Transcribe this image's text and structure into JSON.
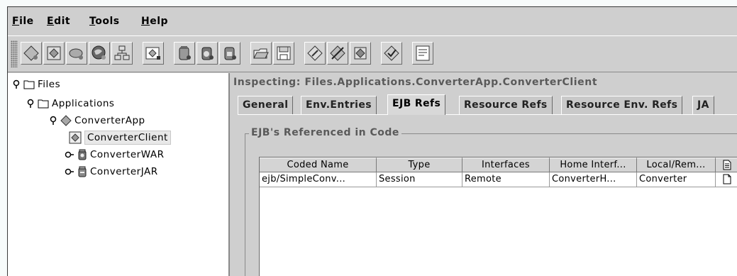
{
  "menu": {
    "file": {
      "key": "F",
      "rest": "ile"
    },
    "edit": {
      "key": "E",
      "rest": "dit"
    },
    "tools": {
      "key": "T",
      "rest": "ools"
    },
    "help": {
      "key": "H",
      "rest": "elp"
    }
  },
  "toolbar": {
    "buttons": [
      "new-application-icon",
      "new-component-icon",
      "new-bean-icon",
      "new-web-icon",
      "new-tree-icon",
      "add-icon",
      "new-jar-icon",
      "new-war-icon",
      "new-client-jar-icon",
      "open-icon",
      "save-icon",
      "edit-icon",
      "verify-icon",
      "deploy-icon",
      "check-icon",
      "descriptor-icon"
    ]
  },
  "tree": {
    "files": "Files",
    "applications": "Applications",
    "converter_app": "ConverterApp",
    "converter_client": "ConverterClient",
    "converter_war": "ConverterWAR",
    "converter_jar": "ConverterJAR"
  },
  "right": {
    "inspecting": "Inspecting: Files.Applications.ConverterApp.ConverterClient",
    "tabs": [
      "General",
      "Env.Entries",
      "EJB Refs",
      "Resource Refs",
      "Resource Env. Refs",
      "JA"
    ],
    "active_tab": "EJB Refs",
    "group_title": "EJB's Referenced in Code",
    "columns": [
      "Coded Name",
      "Type",
      "Interfaces",
      "Home Interf...",
      "Local/Rem..."
    ],
    "rows": [
      [
        "ejb/SimpleConv...",
        "Session",
        "Remote",
        "ConverterH...",
        "Converter"
      ]
    ]
  }
}
